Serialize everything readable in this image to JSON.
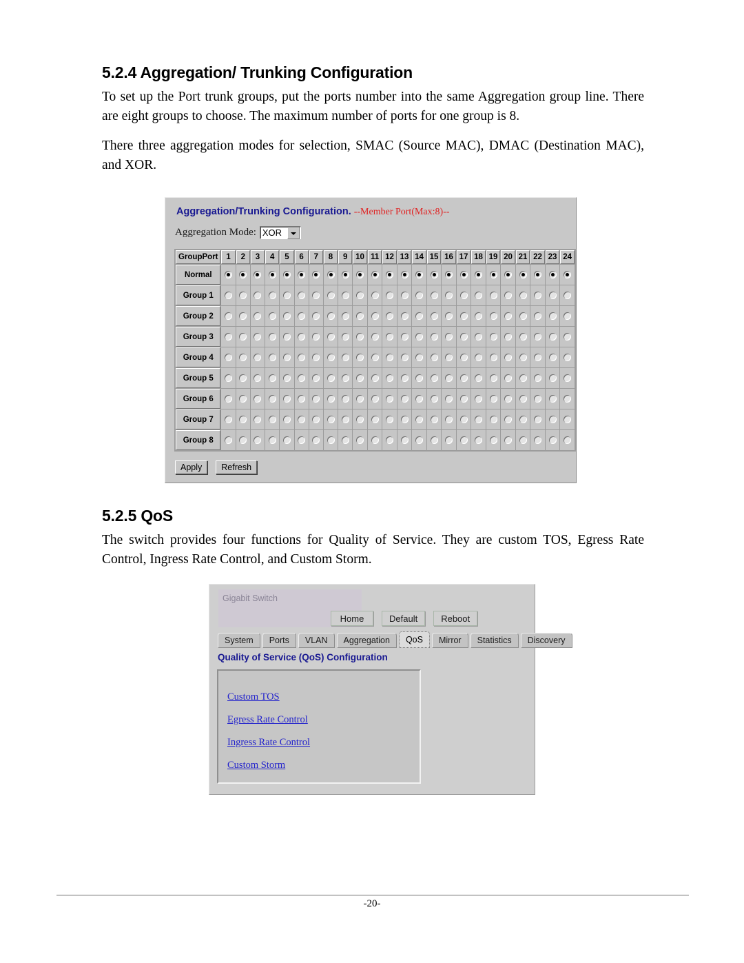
{
  "document": {
    "section_aggregation": {
      "heading": "5.2.4 Aggregation/ Trunking Configuration",
      "paragraph_1": "To set up the Port trunk groups, put the ports number into the same Aggregation group line. There are eight groups to choose. The maximum number of ports for one group is 8.",
      "paragraph_2": "There three aggregation modes for selection, SMAC (Source MAC), DMAC (Destination MAC), and XOR."
    },
    "section_qos": {
      "heading": "5.2.5 QoS",
      "paragraph_1": "The switch provides four functions for Quality of Service. They are custom TOS, Egress Rate Control, Ingress Rate Control, and Custom Storm."
    },
    "footer": {
      "page_number": "-20-"
    }
  },
  "aggregation_screenshot": {
    "title": "Aggregation/Trunking Configuration.",
    "title_note": "--Member Port(Max:8)--",
    "title_color": "#181891",
    "note_color": "#e02020",
    "mode_label": "Aggregation Mode:",
    "mode_value": "XOR",
    "mode_options": [
      "SMAC",
      "DMAC",
      "XOR"
    ],
    "table": {
      "corner_header": "GroupPort",
      "ports": [
        "1",
        "2",
        "3",
        "4",
        "5",
        "6",
        "7",
        "8",
        "9",
        "10",
        "11",
        "12",
        "13",
        "14",
        "15",
        "16",
        "17",
        "18",
        "19",
        "20",
        "21",
        "22",
        "23",
        "24"
      ],
      "rows": [
        {
          "label": "Normal",
          "selected_ports": [
            1,
            2,
            3,
            4,
            5,
            6,
            7,
            8,
            9,
            10,
            11,
            12,
            13,
            14,
            15,
            16,
            17,
            18,
            19,
            20,
            21,
            22,
            23,
            24
          ]
        },
        {
          "label": "Group 1",
          "selected_ports": []
        },
        {
          "label": "Group 2",
          "selected_ports": []
        },
        {
          "label": "Group 3",
          "selected_ports": []
        },
        {
          "label": "Group 4",
          "selected_ports": []
        },
        {
          "label": "Group 5",
          "selected_ports": []
        },
        {
          "label": "Group 6",
          "selected_ports": []
        },
        {
          "label": "Group 7",
          "selected_ports": []
        },
        {
          "label": "Group 8",
          "selected_ports": []
        }
      ]
    },
    "buttons": {
      "apply": "Apply",
      "refresh": "Refresh"
    }
  },
  "qos_screenshot": {
    "logo": "Gigabit Switch",
    "top_buttons": [
      "Home",
      "Default",
      "Reboot"
    ],
    "tabs": [
      {
        "label": "System",
        "active": false
      },
      {
        "label": "Ports",
        "active": false
      },
      {
        "label": "VLAN",
        "active": false
      },
      {
        "label": "Aggregation",
        "active": false
      },
      {
        "label": "QoS",
        "active": true
      },
      {
        "label": "Mirror",
        "active": false
      },
      {
        "label": "Statistics",
        "active": false
      },
      {
        "label": "Discovery",
        "active": false
      }
    ],
    "heading": "Quality of Service (QoS) Configuration",
    "heading_color": "#181891",
    "links": [
      "Custom TOS",
      "Egress Rate Control",
      "Ingress Rate Control",
      "Custom Storm"
    ],
    "link_color": "#2222cc"
  }
}
